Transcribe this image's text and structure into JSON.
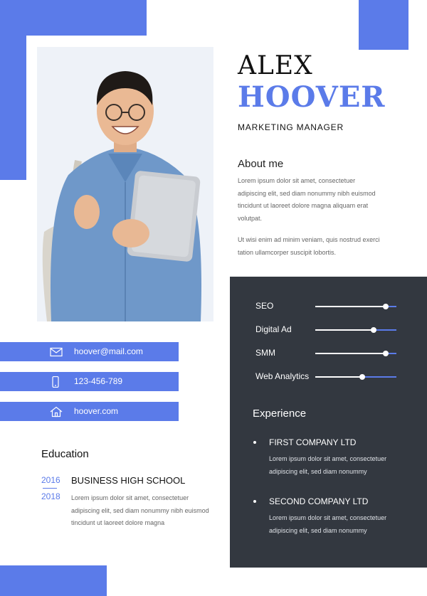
{
  "name": {
    "first": "ALEX",
    "last": "HOOVER"
  },
  "job_title": "MARKETING MANAGER",
  "about": {
    "heading": "About me",
    "p1": "Lorem ipsum dolor sit amet, consectetuer adipiscing elit, sed diam nonummy nibh euismod tincidunt ut laoreet dolore magna aliquam erat volutpat.",
    "p2": "Ut wisi enim ad minim veniam, quis nostrud exerci tation ullamcorper suscipit lobortis."
  },
  "contact": {
    "email": "hoover@mail.com",
    "phone": "123-456-789",
    "website": "hoover.com",
    "icons": [
      "envelope-icon",
      "phone-icon",
      "home-icon"
    ]
  },
  "education": {
    "heading": "Education",
    "year_start": "2016",
    "year_end": "2018",
    "school": "BUSINESS HIGH SCHOOL",
    "description": "Lorem ipsum dolor sit amet, consectetuer adipiscing elit, sed diam nonummy nibh euismod tincidunt ut laoreet dolore magna"
  },
  "skills": [
    {
      "name": "SEO",
      "level": 0.87
    },
    {
      "name": "Digital Ad",
      "level": 0.72
    },
    {
      "name": "SMM",
      "level": 0.87
    },
    {
      "name": "Web Analytics",
      "level": 0.58
    }
  ],
  "experience": {
    "heading": "Experience",
    "items": [
      {
        "company": "FIRST COMPANY LTD",
        "description": "Lorem ipsum dolor sit amet, consectetuer adipiscing elit, sed diam nonummy"
      },
      {
        "company": "SECOND COMPANY LTD",
        "description": "Lorem ipsum dolor sit amet, consectetuer adipiscing elit, sed diam nonummy"
      }
    ]
  },
  "colors": {
    "accent": "#5b7be9",
    "dark_panel": "#333840",
    "text": "#222222"
  }
}
